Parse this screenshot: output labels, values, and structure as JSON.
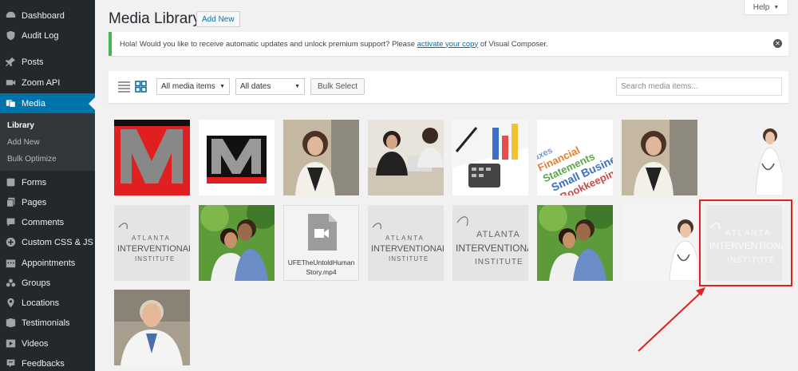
{
  "sidebar": {
    "items": [
      {
        "label": "Dashboard",
        "icon": "dashboard-icon"
      },
      {
        "label": "Audit Log",
        "icon": "shield-icon"
      },
      {
        "label": "Posts",
        "icon": "pin-icon"
      },
      {
        "label": "Zoom API",
        "icon": "video-camera-icon"
      },
      {
        "label": "Media",
        "icon": "media-icon"
      },
      {
        "label": "Forms",
        "icon": "forms-icon"
      },
      {
        "label": "Pages",
        "icon": "pages-icon"
      },
      {
        "label": "Comments",
        "icon": "comment-icon"
      },
      {
        "label": "Custom CSS & JS",
        "icon": "plus-circle-icon"
      },
      {
        "label": "Appointments",
        "icon": "calendar-icon"
      },
      {
        "label": "Groups",
        "icon": "groups-icon"
      },
      {
        "label": "Locations",
        "icon": "location-icon"
      },
      {
        "label": "Testimonials",
        "icon": "testimonial-icon"
      },
      {
        "label": "Videos",
        "icon": "play-icon"
      },
      {
        "label": "Feedbacks",
        "icon": "feedback-icon"
      }
    ],
    "submenu": [
      "Library",
      "Add New",
      "Bulk Optimize"
    ]
  },
  "header": {
    "title": "Media Library",
    "add_new": "Add New",
    "help": "Help"
  },
  "notice": {
    "text_before": "Hola! Would you like to receive automatic updates and unlock premium support? Please ",
    "link": "activate your copy",
    "text_after": " of Visual Composer."
  },
  "toolbar": {
    "media_filter": "All media items",
    "date_filter": "All dates",
    "bulk_select": "Bulk Select",
    "search_placeholder": "Search media items..."
  },
  "media": {
    "video_filename": "UFETheUntoldHumanStory.mp4",
    "items": [
      "logo-m-red",
      "logo-m-small",
      "woman-portrait",
      "business-meeting",
      "financial-charts",
      "accounting-words",
      "woman-portrait",
      "female-doctor",
      "atlanta-logo",
      "couple-smiling",
      "video-file",
      "atlanta-logo",
      "atlanta-logo",
      "couple-smiling",
      "female-doctor",
      "atlanta-logo-faded",
      "male-doctor"
    ]
  },
  "colors": {
    "sidebar_bg": "#23282d",
    "active_bg": "#0073aa",
    "accent_link": "#0073aa",
    "notice_border": "#46b450",
    "highlight": "#e0201c"
  }
}
